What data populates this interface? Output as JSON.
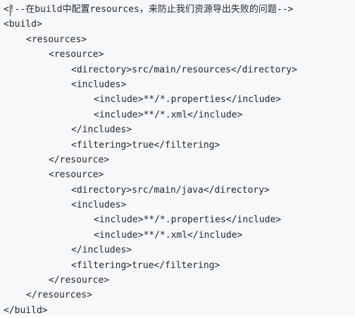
{
  "code": {
    "lines": [
      {
        "indent": 0,
        "text": "<!--在build中配置resources，来防止我们资源导出失败的问题-->"
      },
      {
        "indent": 0,
        "text": "<build>"
      },
      {
        "indent": 1,
        "text": "<resources>"
      },
      {
        "indent": 2,
        "text": "<resource>"
      },
      {
        "indent": 3,
        "text": "<directory>src/main/resources</directory>"
      },
      {
        "indent": 3,
        "text": "<includes>"
      },
      {
        "indent": 4,
        "text": "<include>**/*.properties</include>"
      },
      {
        "indent": 4,
        "text": "<include>**/*.xml</include>"
      },
      {
        "indent": 3,
        "text": "</includes>"
      },
      {
        "indent": 3,
        "text": "<filtering>true</filtering>"
      },
      {
        "indent": 2,
        "text": "</resource>"
      },
      {
        "indent": 2,
        "text": "<resource>"
      },
      {
        "indent": 3,
        "text": "<directory>src/main/java</directory>"
      },
      {
        "indent": 3,
        "text": "<includes>"
      },
      {
        "indent": 4,
        "text": "<include>**/*.properties</include>"
      },
      {
        "indent": 4,
        "text": "<include>**/*.xml</include>"
      },
      {
        "indent": 3,
        "text": "</includes>"
      },
      {
        "indent": 3,
        "text": "<filtering>true</filtering>"
      },
      {
        "indent": 2,
        "text": "</resource>"
      },
      {
        "indent": 1,
        "text": "</resources>"
      },
      {
        "indent": 0,
        "text": "</build>"
      }
    ]
  }
}
